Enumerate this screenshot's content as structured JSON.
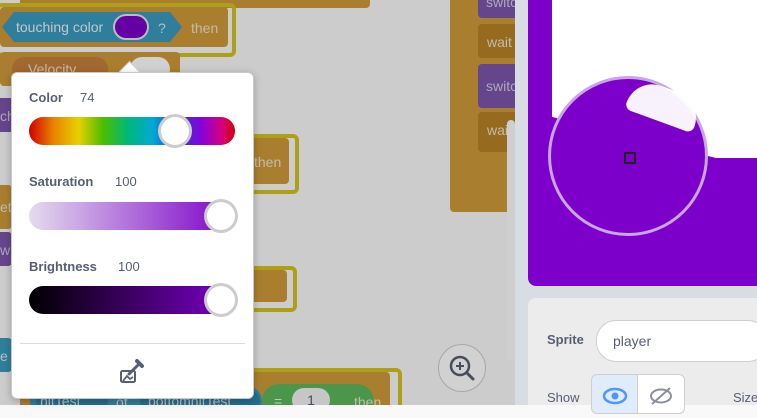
{
  "workspace": {
    "touching_color_label": "touching color",
    "question_mark": "?",
    "then_label_1": "then",
    "velocity_label": "Velocity",
    "then_label_2": "then",
    "hittest_label": "hitTest",
    "of_label": "of",
    "bottomhittest_label": "bottomhitTest",
    "equals_label": "=",
    "equals_value": "1",
    "then_label_3": "then",
    "right_blocks": [
      "switc",
      "wait",
      "switc",
      "wai"
    ],
    "left_edge_fragments": [
      "ch",
      "et",
      "wi",
      "e"
    ]
  },
  "color_picker": {
    "color_label": "Color",
    "color_value": "74",
    "saturation_label": "Saturation",
    "saturation_value": "100",
    "brightness_label": "Brightness",
    "brightness_value": "100",
    "color_fraction": 0.74,
    "saturation_fraction": 1.0,
    "brightness_fraction": 1.0,
    "eyedropper_icon": "eyedropper-icon",
    "selected_color": "#7c00c9"
  },
  "sprite_info": {
    "sprite_label": "Sprite",
    "sprite_name": "player",
    "show_label": "Show",
    "size_label": "Size"
  },
  "colors": {
    "stage_purple": "#7c00c9",
    "block_orange": "#cf9b3a",
    "sensing_blue": "#3a9abf"
  }
}
